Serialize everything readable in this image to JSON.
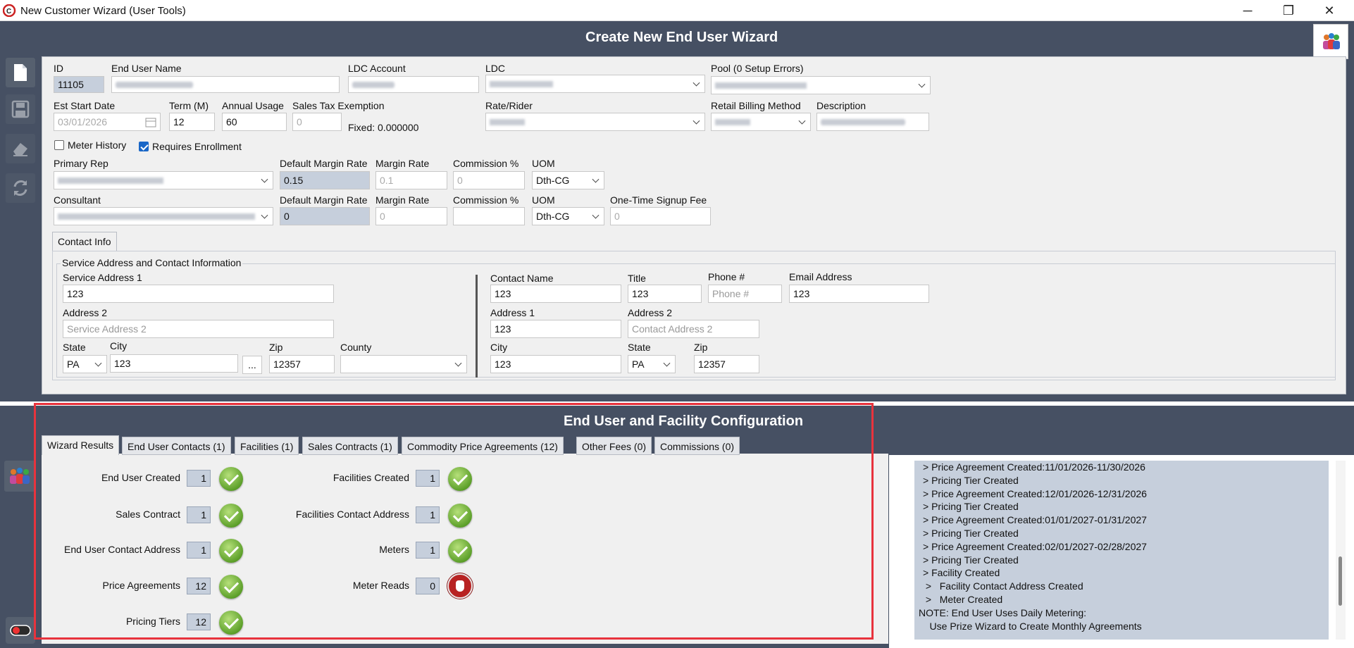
{
  "window": {
    "title": "New Customer Wizard (User Tools)",
    "minimize": "─",
    "restore": "❐",
    "close": "✕"
  },
  "top": {
    "title": "Create New End User Wizard"
  },
  "form": {
    "id_label": "ID",
    "id_value": "11105",
    "name_label": "End User Name",
    "ldc_account_label": "LDC Account",
    "ldc_label": "LDC",
    "pool_label": "Pool (0 Setup Errors)",
    "start_label": "Est Start Date",
    "start_value": "03/01/2026",
    "term_label": "Term (M)",
    "term_value": "12",
    "usage_label": "Annual Usage",
    "usage_value": "60",
    "tax_label": "Sales Tax Exemption",
    "tax_value": "0",
    "fixed_text": "Fixed: 0.000000",
    "rate_label": "Rate/Rider",
    "retail_label": "Retail Billing Method",
    "desc_label": "Description",
    "meter_history_label": "Meter History",
    "requires_enrollment_label": "Requires Enrollment",
    "primary_rep_label": "Primary Rep",
    "default_margin_label": "Default Margin Rate",
    "default_margin_value": "0.15",
    "margin_label": "Margin Rate",
    "margin_value": "0.1",
    "commission_label": "Commission %",
    "commission_value": "0",
    "uom_label": "UOM",
    "uom_value": "Dth-CG",
    "consultant_label": "Consultant",
    "c_default_margin_label": "Default Margin Rate",
    "c_default_margin_value": "0",
    "c_margin_label": "Margin Rate",
    "c_margin_value": "0",
    "c_commission_label": "Commission %",
    "c_commission_value": "",
    "c_uom_label": "UOM",
    "c_uom_value": "Dth-CG",
    "signup_label": "One-Time Signup Fee",
    "signup_value": "0"
  },
  "contact": {
    "tab": "Contact Info",
    "group": "Service Address and Contact Information",
    "svc1_label": "Service Address 1",
    "svc1_value": "123",
    "addr2_label": "Address 2",
    "addr2_placeholder": "Service Address 2",
    "state_label": "State",
    "state_value": "PA",
    "city_label": "City",
    "city_value": "123",
    "dots": "...",
    "zip_label": "Zip",
    "zip_value": "12357",
    "county_label": "County",
    "cname_label": "Contact Name",
    "cname_value": "123",
    "title_label": "Title",
    "title_value": "123",
    "phone_label": "Phone #",
    "phone_placeholder": "Phone #",
    "email_label": "Email Address",
    "email_value": "123",
    "caddr1_label": "Address 1",
    "caddr1_value": "123",
    "caddr2_label": "Address 2",
    "caddr2_placeholder": "Contact Address 2",
    "ccity_label": "City",
    "ccity_value": "123",
    "cstate_label": "State",
    "cstate_value": "PA",
    "czip_label": "Zip",
    "czip_value": "12357"
  },
  "bottom": {
    "title": "End User and Facility Configuration",
    "tabs": [
      "Wizard Results",
      "End User Contacts (1)",
      "Facilities (1)",
      "Sales Contracts (1)",
      "Commodity Price Agreements (12)",
      "Other Fees (0)",
      "Commissions (0)"
    ],
    "results_left": [
      {
        "label": "End User Created",
        "count": "1",
        "status": "ok"
      },
      {
        "label": "Sales Contract",
        "count": "1",
        "status": "ok"
      },
      {
        "label": "End User Contact Address",
        "count": "1",
        "status": "ok"
      },
      {
        "label": "Price Agreements",
        "count": "12",
        "status": "ok"
      },
      {
        "label": "Pricing Tiers",
        "count": "12",
        "status": "ok"
      }
    ],
    "results_right": [
      {
        "label": "Facilities Created",
        "count": "1",
        "status": "ok"
      },
      {
        "label": "Facilities Contact Address",
        "count": "1",
        "status": "ok"
      },
      {
        "label": "Meters",
        "count": "1",
        "status": "ok"
      },
      {
        "label": "Meter Reads",
        "count": "0",
        "status": "stop"
      }
    ],
    "log": [
      " > Price Agreement Created:11/01/2026-11/30/2026",
      " > Pricing Tier Created",
      " > Price Agreement Created:12/01/2026-12/31/2026",
      " > Pricing Tier Created",
      " > Price Agreement Created:01/01/2027-01/31/2027",
      " > Pricing Tier Created",
      " > Price Agreement Created:02/01/2027-02/28/2027",
      " > Pricing Tier Created",
      " > Facility Created",
      " >   Facility Contact Address Created",
      " >   Meter Created",
      "NOTE: End User Uses Daily Metering:",
      "    Use Prize Wizard to Create Monthly Agreements"
    ]
  },
  "colors": {
    "header": "#465063",
    "highlight": "#e8333d",
    "field_blue": "#c6cfdc"
  }
}
